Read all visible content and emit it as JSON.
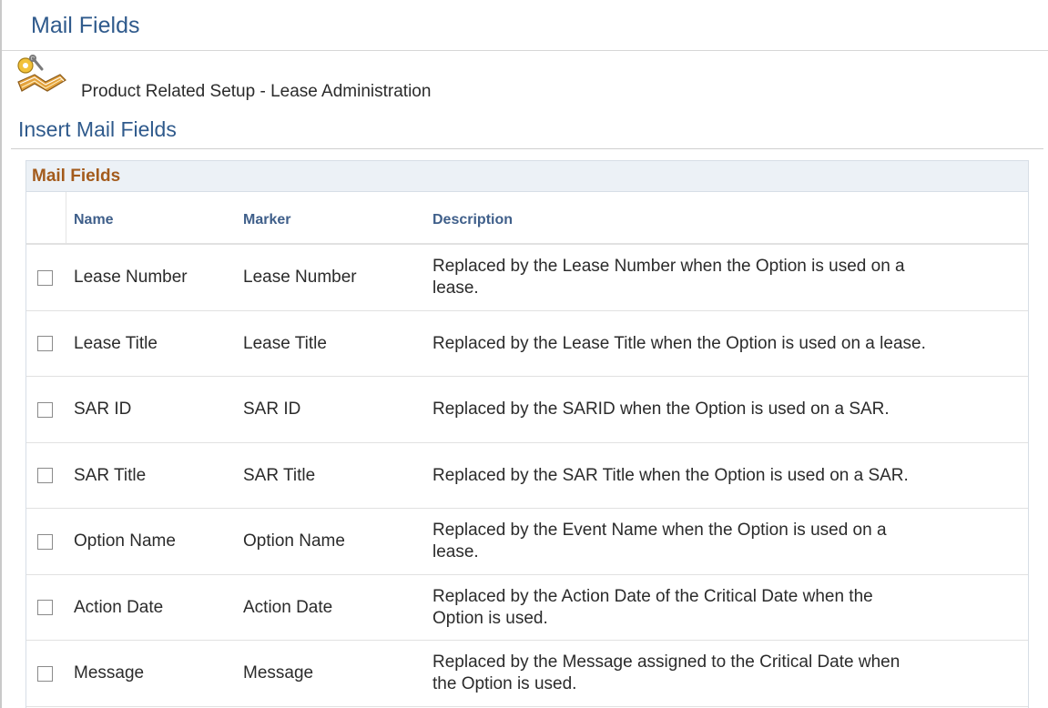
{
  "page": {
    "title": "Mail Fields"
  },
  "product": {
    "icon": "product-setup-book-tools-icon",
    "label": "Product Related Setup - Lease Administration"
  },
  "section": {
    "title": "Insert Mail Fields"
  },
  "grid": {
    "title": "Mail Fields",
    "columns": [
      "Name",
      "Marker",
      "Description"
    ],
    "rows": [
      {
        "name": "Lease Number",
        "marker": "Lease Number",
        "description": [
          "Replaced by the Lease Number when the Option is used on a",
          "lease."
        ],
        "checked": false
      },
      {
        "name": "Lease Title",
        "marker": "Lease Title",
        "description": [
          "Replaced by the Lease Title when the Option is used on a lease."
        ],
        "checked": false
      },
      {
        "name": "SAR ID",
        "marker": "SAR ID",
        "description": [
          "Replaced by the SARID when the Option is used on a SAR."
        ],
        "checked": false
      },
      {
        "name": "SAR Title",
        "marker": "SAR Title",
        "description": [
          "Replaced by the SAR Title when the Option is used on a SAR."
        ],
        "checked": false
      },
      {
        "name": "Option Name",
        "marker": "Option Name",
        "description": [
          "Replaced by the Event Name when the Option is used on a",
          "lease."
        ],
        "checked": false
      },
      {
        "name": "Action Date",
        "marker": "Action Date",
        "description": [
          "Replaced by the Action Date of the Critical Date when the",
          "Option is used."
        ],
        "checked": false
      },
      {
        "name": "Message",
        "marker": "Message",
        "description": [
          "Replaced by the Message assigned to the Critical Date when",
          "the Option is used."
        ],
        "checked": false
      }
    ]
  },
  "colors": {
    "heading_blue": "#2f5a8c",
    "grid_title": "#a35b1c",
    "column_header": "#3f5f8a"
  }
}
